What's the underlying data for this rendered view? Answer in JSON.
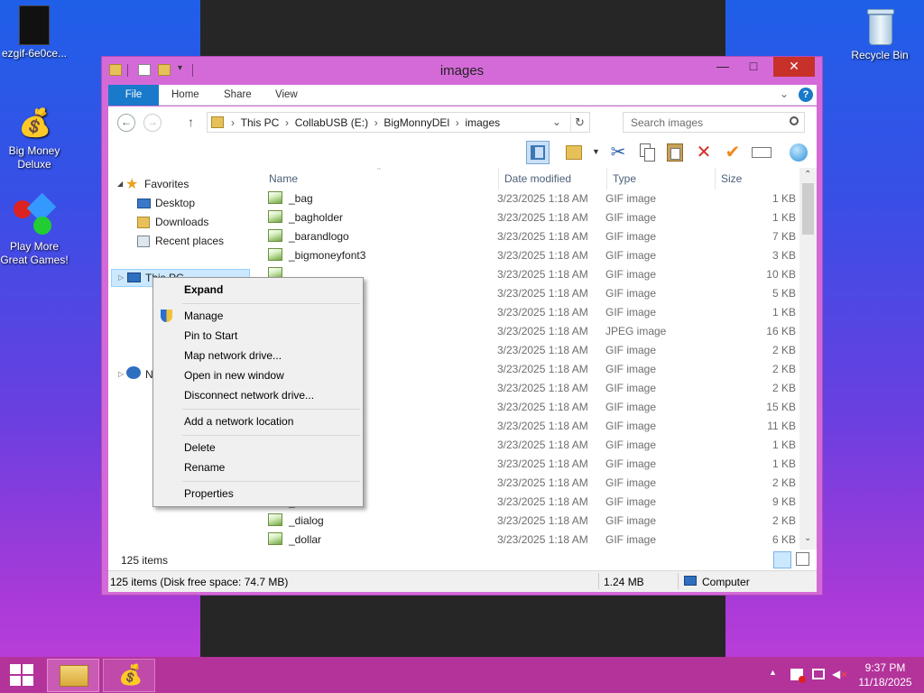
{
  "desktop": {
    "icons": [
      {
        "label": "ezgif-6e0ce...",
        "icon": "gif-file-icon"
      },
      {
        "label": "Big Money Deluxe",
        "icon": "money-bag-shortcut-icon"
      },
      {
        "label": "Play More Great Games!",
        "icon": "game-shortcut-icon"
      },
      {
        "label": "Recycle Bin",
        "icon": "recycle-bin-icon"
      }
    ]
  },
  "window": {
    "title": "images",
    "controls": {
      "minimize": "—",
      "maximize": "□",
      "close": "✕"
    },
    "ribbon_tabs": [
      "File",
      "Home",
      "Share",
      "View"
    ],
    "address": {
      "back": "←",
      "forward": "→",
      "up": "↑",
      "crumbs": [
        "This PC",
        "CollabUSB (E:)",
        "BigMonnyDEl",
        "images"
      ],
      "search_placeholder": "Search images"
    },
    "toolbar_icons": [
      "pane-icon",
      "folder-options-icon",
      "cut-icon",
      "copy-icon",
      "paste-icon",
      "delete-icon",
      "checkmark-icon",
      "rename-icon",
      "network-icon"
    ],
    "nav": {
      "favorites_label": "Favorites",
      "items": [
        "Desktop",
        "Downloads",
        "Recent places"
      ],
      "thispc_label": "This PC",
      "network_label": "N"
    },
    "columns": {
      "name": "Name",
      "date": "Date modified",
      "type": "Type",
      "size": "Size"
    },
    "files": [
      {
        "name": "_bag",
        "date": "3/23/2025 1:18 AM",
        "type": "GIF image",
        "size": "1 KB"
      },
      {
        "name": "_bagholder",
        "date": "3/23/2025 1:18 AM",
        "type": "GIF image",
        "size": "1 KB"
      },
      {
        "name": "_barandlogo",
        "date": "3/23/2025 1:18 AM",
        "type": "GIF image",
        "size": "7 KB"
      },
      {
        "name": "_bigmoneyfont3",
        "date": "3/23/2025 1:18 AM",
        "type": "GIF image",
        "size": "3 KB"
      },
      {
        "name": "",
        "date": "3/23/2025 1:18 AM",
        "type": "GIF image",
        "size": "10 KB"
      },
      {
        "name": "",
        "date": "3/23/2025 1:18 AM",
        "type": "GIF image",
        "size": "5 KB"
      },
      {
        "name": "",
        "date": "3/23/2025 1:18 AM",
        "type": "GIF image",
        "size": "1 KB"
      },
      {
        "name": "",
        "date": "3/23/2025 1:18 AM",
        "type": "JPEG image",
        "size": "16 KB"
      },
      {
        "name": "",
        "date": "3/23/2025 1:18 AM",
        "type": "GIF image",
        "size": "2 KB"
      },
      {
        "name": "",
        "date": "3/23/2025 1:18 AM",
        "type": "GIF image",
        "size": "2 KB"
      },
      {
        "name": "",
        "date": "3/23/2025 1:18 AM",
        "type": "GIF image",
        "size": "2 KB"
      },
      {
        "name": "",
        "date": "3/23/2025 1:18 AM",
        "type": "GIF image",
        "size": "15 KB"
      },
      {
        "name": "",
        "date": "3/23/2025 1:18 AM",
        "type": "GIF image",
        "size": "11 KB"
      },
      {
        "name": "g",
        "date": "3/23/2025 1:18 AM",
        "type": "GIF image",
        "size": "1 KB"
      },
      {
        "name": "",
        "date": "3/23/2025 1:18 AM",
        "type": "GIF image",
        "size": "1 KB"
      },
      {
        "name": "",
        "date": "3/23/2025 1:18 AM",
        "type": "GIF image",
        "size": "2 KB"
      },
      {
        "name": "_deluxor",
        "date": "3/23/2025 1:18 AM",
        "type": "GIF image",
        "size": "9 KB"
      },
      {
        "name": "_dialog",
        "date": "3/23/2025 1:18 AM",
        "type": "GIF image",
        "size": "2 KB"
      },
      {
        "name": "_dollar",
        "date": "3/23/2025 1:18 AM",
        "type": "GIF image",
        "size": "6 KB"
      }
    ],
    "items_count": "125 items",
    "status": {
      "left": "125 items (Disk free space: 74.7 MB)",
      "size": "1.24 MB",
      "location": "Computer"
    }
  },
  "context_menu": {
    "items": [
      "Expand",
      "Manage",
      "Pin to Start",
      "Map network drive...",
      "Open in new window",
      "Disconnect network drive...",
      "Add a network location",
      "Delete",
      "Rename",
      "Properties"
    ]
  },
  "taskbar": {
    "time": "9:37 PM",
    "date": "11/18/2025"
  }
}
